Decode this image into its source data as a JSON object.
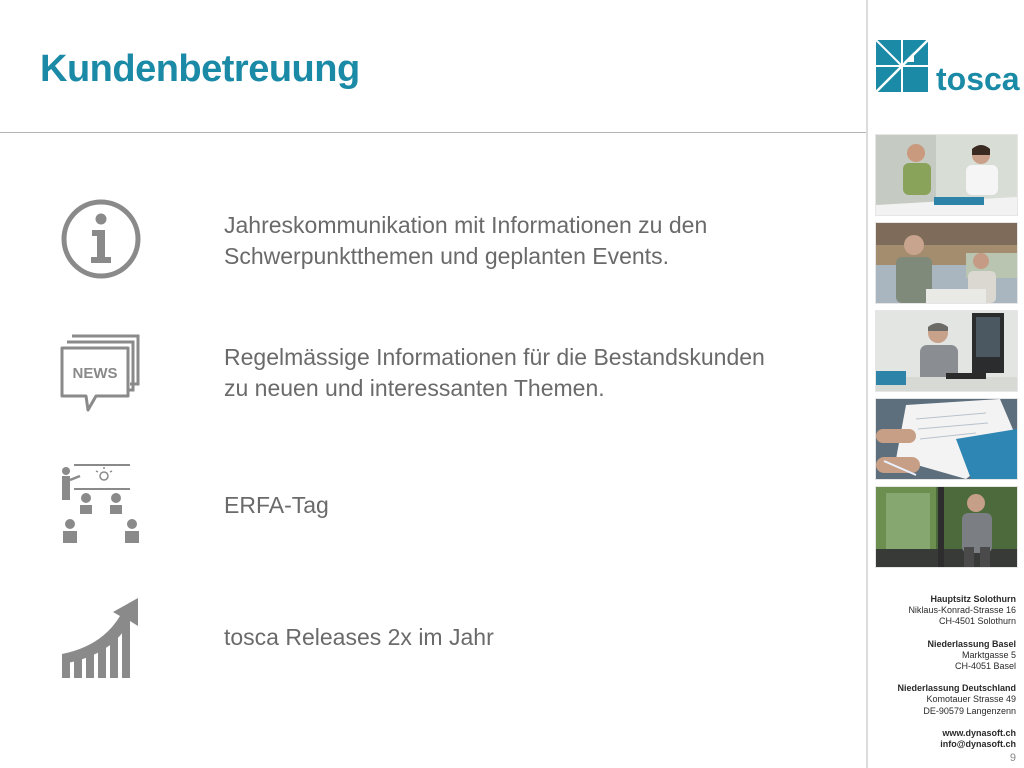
{
  "slide": {
    "title": "Kundenbetreuung",
    "page_number": "9"
  },
  "items": [
    {
      "icon": "info-icon",
      "lines": [
        "Jahreskommunikation mit Informationen zu den",
        "Schwerpunktthemen und geplanten Events."
      ]
    },
    {
      "icon": "news-icon",
      "icon_text": "NEWS",
      "lines": [
        "Regelmässige Informationen für die Bestandskunden",
        "zu neuen und interessanten Themen."
      ]
    },
    {
      "icon": "workshop-icon",
      "lines": [
        "ERFA-Tag"
      ]
    },
    {
      "icon": "growth-chart-icon",
      "lines": [
        "tosca Releases 2x im Jahr"
      ]
    }
  ],
  "sidebar": {
    "logo_text": "tosca",
    "photos": [
      "meeting-photo",
      "colleagues-photo",
      "developer-photo",
      "documents-photo",
      "consultant-photo"
    ],
    "contact": [
      {
        "heading": "Hauptsitz Solothurn",
        "lines": [
          "Niklaus-Konrad-Strasse 16",
          "CH-4501 Solothurn"
        ]
      },
      {
        "heading": "Niederlassung Basel",
        "lines": [
          "Marktgasse 5",
          "CH-4051 Basel"
        ]
      },
      {
        "heading": "Niederlassung Deutschland",
        "lines": [
          "Komotauer Strasse 49",
          "DE-90579 Langenzenn"
        ]
      },
      {
        "heading": "",
        "bold_lines": [
          "www.dynasoft.ch",
          "info@dynasoft.ch"
        ]
      }
    ]
  },
  "colors": {
    "accent": "#1a8aa6",
    "text": "#6a6a6a",
    "icon": "#8a8a8a"
  }
}
